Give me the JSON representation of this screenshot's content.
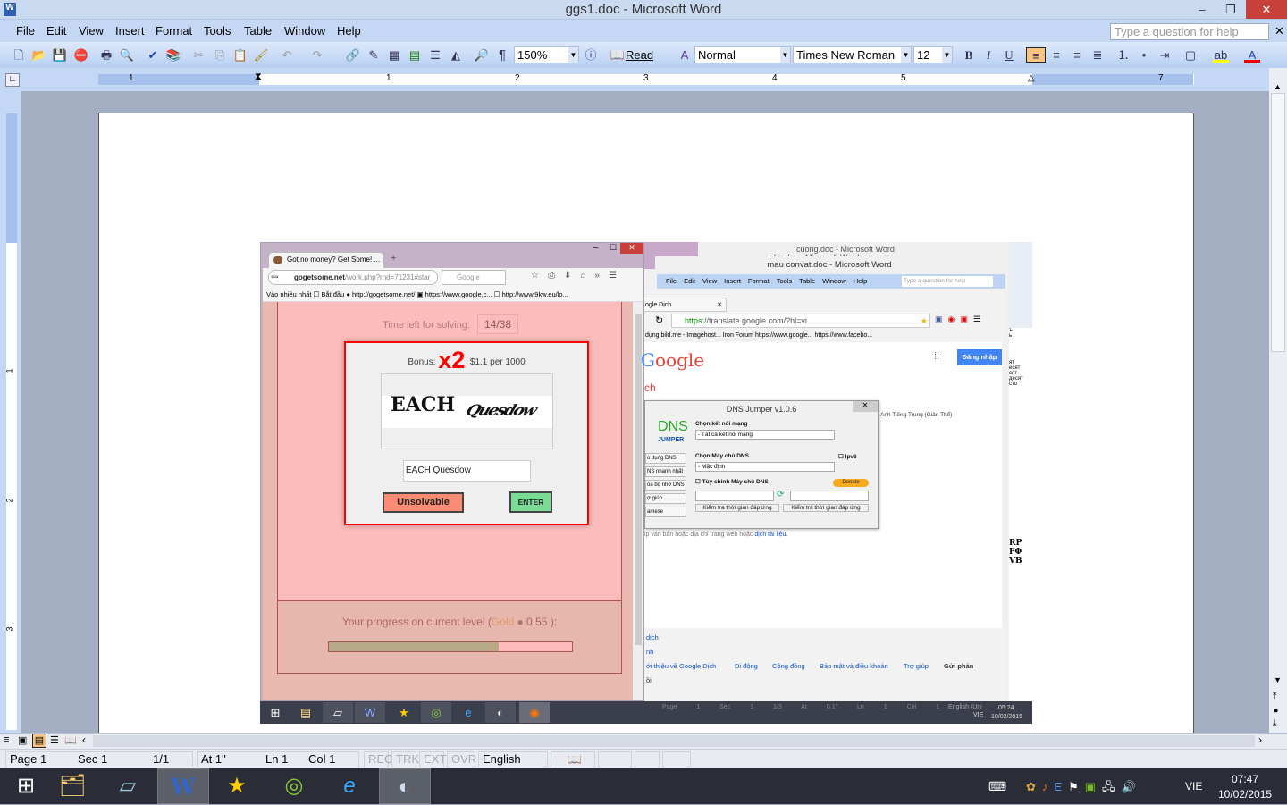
{
  "window": {
    "title": "ggs1.doc - Microsoft Word",
    "help_placeholder": "Type a question for help"
  },
  "menu": [
    "File",
    "Edit",
    "View",
    "Insert",
    "Format",
    "Tools",
    "Table",
    "Window",
    "Help"
  ],
  "toolbar": {
    "zoom": "150%",
    "read": "Read",
    "style": "Normal",
    "font": "Times New Roman",
    "size": "12",
    "bold": "B",
    "italic": "I",
    "underline": "U"
  },
  "ruler": {
    "labels": [
      "1",
      "1",
      "2",
      "3",
      "4",
      "5",
      "7"
    ]
  },
  "vruler": {
    "labels": [
      "1",
      "2",
      "3"
    ]
  },
  "status": {
    "page": "Page 1",
    "sec": "Sec 1",
    "pages": "1/1",
    "at": "At 1\"",
    "ln": "Ln 1",
    "col": "Col 1",
    "rec": "REC",
    "trk": "TRK",
    "ext": "EXT",
    "ovr": "OVR",
    "lang": "English (U.S."
  },
  "tray": {
    "lang": "VIE",
    "time": "07:47",
    "date": "10/02/2015"
  },
  "embedded": {
    "firefox": {
      "tab": "Got no money? Get Some! ...",
      "url_host": "gogetsome.net",
      "url_path": "/work.php?rnd=71231#star",
      "search": "Google",
      "bookmarks": [
        "Vào nhiều nhất",
        "Bắt đầu",
        "http://gogetsome.net/",
        "https://www.google.c...",
        "http://www.9kw.eu/lo..."
      ],
      "time_label": "Time left for solving:",
      "time_value": "14/38",
      "bonus_label": "Bonus:",
      "bonus_mult": "x2",
      "rate": "$1.1 per 1000",
      "captcha_word1": "EACH",
      "captcha_word2": "Quesdow",
      "answer": "EACH Quesdow",
      "unsolvable": "Unsolvable",
      "enter": "ENTER",
      "progress_prefix": "Your progress on current level (",
      "progress_level": "Gold",
      "progress_value": "0.55",
      "progress_suffix": " ):",
      "progress_fraction": 0.7
    },
    "word2": {
      "title": "mau convat.doc - Microsoft Word",
      "ghost1": "nhu.doc - Microsoft Word",
      "ghost2": "cuong.doc - Microsoft Word",
      "menu": [
        "File",
        "Edit",
        "View",
        "Insert",
        "Format",
        "Tools",
        "Table",
        "Window",
        "Help"
      ],
      "help": "Type a question for help"
    },
    "chrome": {
      "tab": "ogle Dịch",
      "url_scheme": "https:",
      "url_rest": "//translate.google.com/?hl=vi",
      "bookmarks": "dụng   bild.me - Imagehost...   Iron Forum   https://www.google...   https://www.facebo...",
      "logo": "oogle",
      "login": "Đăng nhập",
      "heading": "ch",
      "hint": "ip văn bản hoặc địa chỉ trang web hoặc ",
      "hint_link": "dịch tài liệu.",
      "lang_tabs": "Anh   Tiếng Trung (Giản Thể)",
      "footer_links": [
        "dịch",
        "nh",
        "ới thiệu về Google Dịch",
        "Di động",
        "Cộng đồng",
        "Bảo mật và điều khoản",
        "Trợ giúp"
      ],
      "footer_send": "Gửi phản",
      "footer_end": "ồi"
    },
    "dns": {
      "title": "DNS Jumper v1.0.6",
      "logo": "DNS",
      "logo_sub": "JUMPER",
      "net_label": "Chọn kết nối mạng",
      "net_value": "- Tất cả kết nối mạng",
      "server_label": "Chọn Máy chủ DNS",
      "server_value": "-  Mặc định",
      "ipv6": "Ipv6",
      "custom": "Tùy chỉnh Máy chủ DNS",
      "donate": "Donate",
      "test1": "Kiểm tra thời gian đáp ứng",
      "test2": "Kiểm tra thời gian đáp ứng",
      "side": [
        "o dụng DNS",
        "NS nhanh nhất",
        "ỏa bộ nhớ DNS",
        "ợ giúp",
        "amese"
      ]
    },
    "inner_status": {
      "page": "Page 1",
      "sec": "Sec 1",
      "pages": "1/3",
      "at": "At 0.1\"",
      "ln": "Ln 1",
      "col": "Col 1",
      "lang": "English (Uni",
      "time": "05:24",
      "date": "10/02/2015",
      "lang2": "VIE"
    },
    "right_strip": [
      "ъ",
      "ь",
      "ят",
      "еcят",
      "сят",
      "десят",
      "сто",
      "RP",
      "FΦ",
      "VB"
    ]
  }
}
